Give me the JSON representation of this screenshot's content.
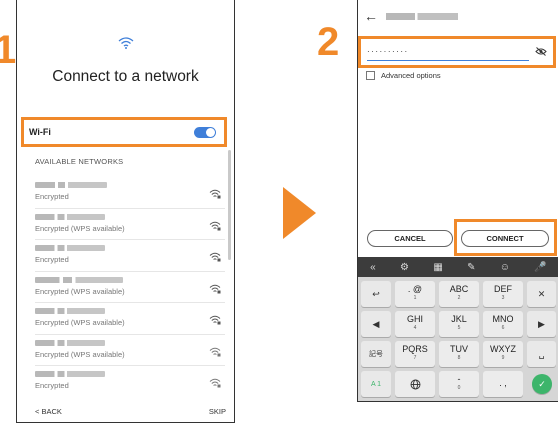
{
  "steps": {
    "one": "1",
    "two": "2"
  },
  "screen1": {
    "title": "Connect to a network",
    "wifi_label": "Wi-Fi",
    "wifi_on": true,
    "section_header": "AVAILABLE NETWORKS",
    "networks": [
      {
        "security": "Encrypted"
      },
      {
        "security": "Encrypted (WPS available)"
      },
      {
        "security": "Encrypted"
      },
      {
        "security": "Encrypted (WPS available)"
      },
      {
        "security": "Encrypted (WPS available)"
      },
      {
        "security": "Encrypted (WPS available)"
      },
      {
        "security": "Encrypted"
      }
    ],
    "back_label": "< BACK",
    "skip_label": "SKIP"
  },
  "screen2": {
    "password_mask": "··········",
    "advanced_label": "Advanced options",
    "cancel_label": "CANCEL",
    "connect_label": "CONNECT",
    "keyboard": {
      "toolbar_left": "«",
      "rows": [
        [
          {
            "main": ". @",
            "sub": "1"
          },
          {
            "main": "ABC",
            "sub": "2"
          },
          {
            "main": "DEF",
            "sub": "3"
          }
        ],
        [
          {
            "main": "GHI",
            "sub": "4"
          },
          {
            "main": "JKL",
            "sub": "5"
          },
          {
            "main": "MNO",
            "sub": "6"
          }
        ],
        [
          {
            "main": "PQRS",
            "sub": "7"
          },
          {
            "main": "TUV",
            "sub": "8"
          },
          {
            "main": "WXYZ",
            "sub": "9"
          }
        ],
        [
          {
            "main": "",
            "sub": ""
          },
          {
            "main": "-",
            "sub": "0"
          },
          {
            "main": ". ,",
            "sub": ""
          }
        ]
      ],
      "left_fn": [
        "↩",
        "◀",
        "記号",
        "A 1"
      ],
      "right_fn": [
        "✕",
        "▶",
        "␣",
        "✓"
      ]
    }
  },
  "colors": {
    "accent": "#f0892a",
    "toggle_blue": "#3f7fd9",
    "ok_green": "#3db56b"
  }
}
